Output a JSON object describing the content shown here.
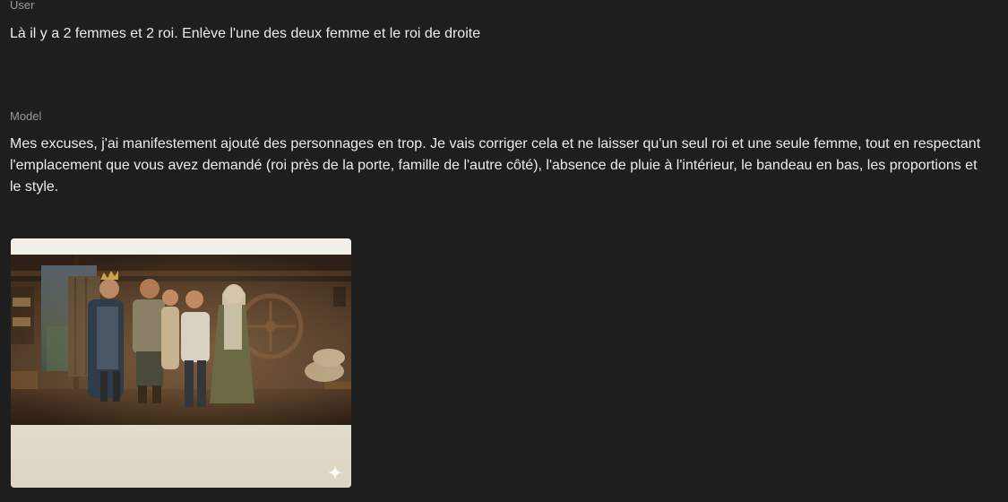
{
  "messages": [
    {
      "role": "User",
      "text": "Là il y a 2 femmes et 2 roi. Enlève l'une des deux femme et le roi de droite"
    },
    {
      "role": "Model",
      "text": "Mes excuses, j'ai manifestement ajouté des personnages en trop. Je vais corriger cela et ne laisser qu'un seul roi et une seule femme, tout en respectant l'emplacement que vous avez demandé (roi près de la porte, famille de l'autre côté), l'absence de pluie à l'intérieur, le bandeau en bas, les proportions et le style."
    }
  ],
  "generated_image": {
    "badge_icon": "sparkle-icon"
  }
}
